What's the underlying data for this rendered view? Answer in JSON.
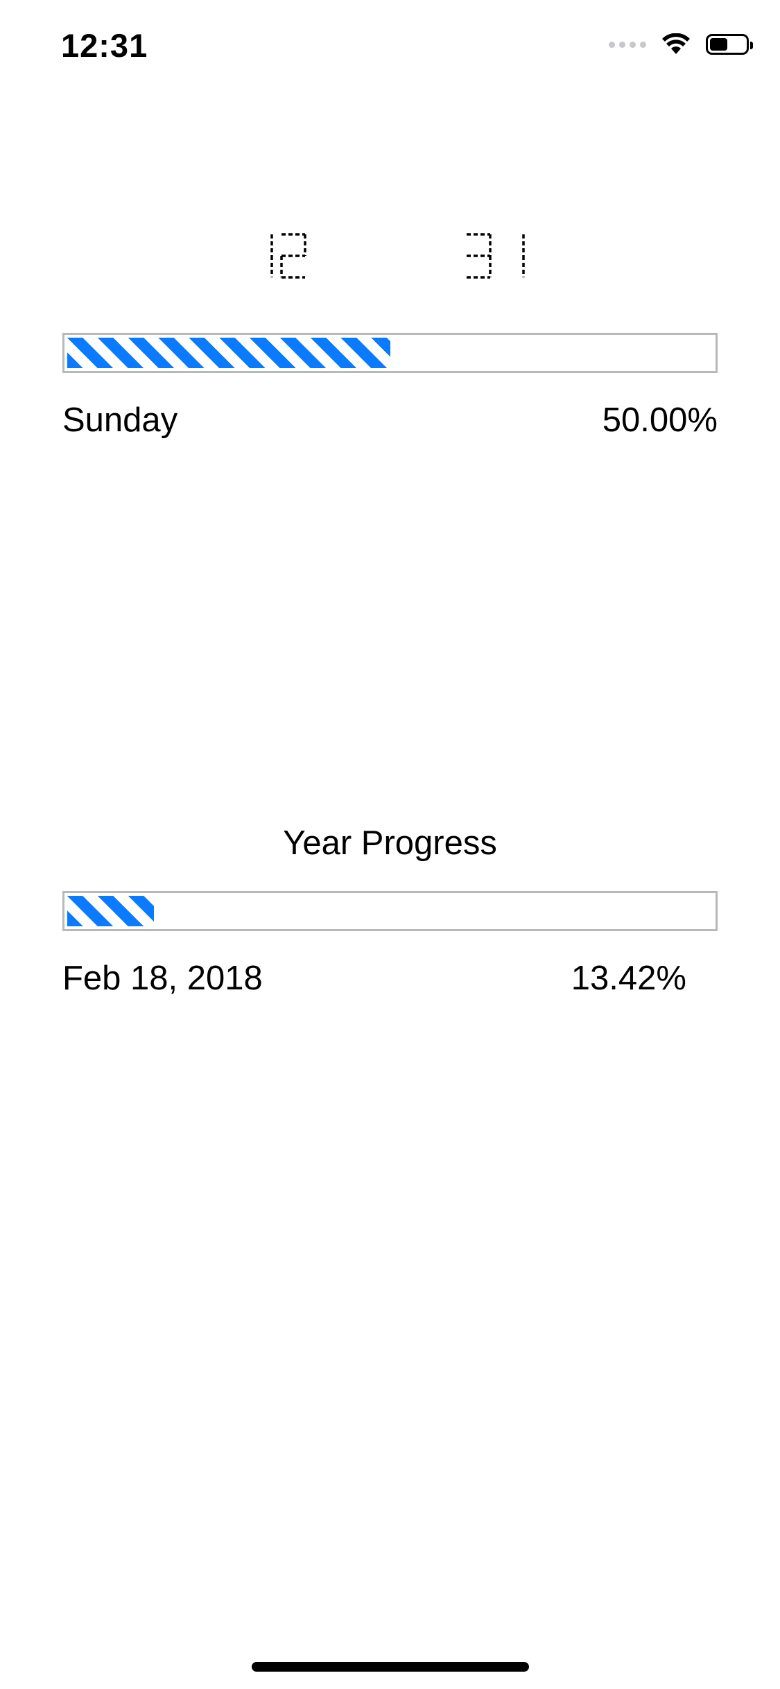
{
  "status_bar": {
    "time": "12:31",
    "battery_level": 0.5,
    "icons": [
      "signal-dots-icon",
      "wifi-icon",
      "battery-icon"
    ]
  },
  "clock": {
    "hours": "12",
    "minutes": "31",
    "style": "dashed-seven-segment"
  },
  "day_progress": {
    "day_label": "Sunday",
    "percent_text": "50.00%",
    "fraction": 0.5,
    "fill_color": "#0a7bff"
  },
  "year_progress": {
    "title": "Year Progress",
    "date_label": "Feb 18, 2018",
    "percent_text": "13.42%",
    "fraction": 0.1342,
    "fill_color": "#0a7bff"
  }
}
